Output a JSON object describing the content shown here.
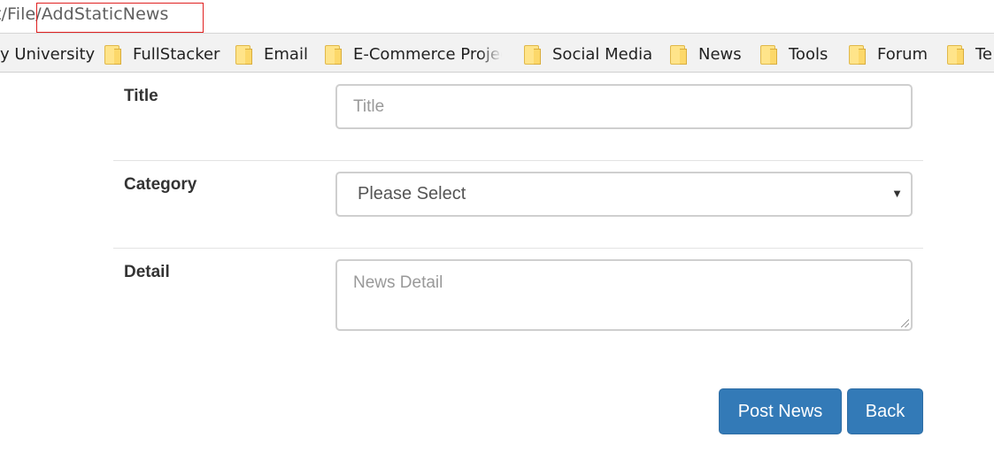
{
  "browser": {
    "url": "t/File/AddStaticNews"
  },
  "bookmarks": [
    {
      "label": "y University",
      "icon": "folder-icon"
    },
    {
      "label": "FullStacker",
      "icon": "folder-icon"
    },
    {
      "label": "Email",
      "icon": "folder-icon"
    },
    {
      "label": "E-Commerce Projec",
      "icon": "folder-icon"
    },
    {
      "label": "Social Media",
      "icon": "folder-icon"
    },
    {
      "label": "News",
      "icon": "folder-icon"
    },
    {
      "label": "Tools",
      "icon": "folder-icon"
    },
    {
      "label": "Forum",
      "icon": "folder-icon"
    },
    {
      "label": "Te",
      "icon": "folder-icon"
    }
  ],
  "form": {
    "title": {
      "label": "Title",
      "placeholder": "Title",
      "value": ""
    },
    "category": {
      "label": "Category",
      "selected": "Please Select",
      "arrow": "▼"
    },
    "detail": {
      "label": "Detail",
      "placeholder": "News Detail",
      "value": ""
    }
  },
  "actions": {
    "post_label": "Post News",
    "back_label": "Back"
  },
  "colors": {
    "primary_button": "#337ab7",
    "highlight_box": "#e02020"
  }
}
